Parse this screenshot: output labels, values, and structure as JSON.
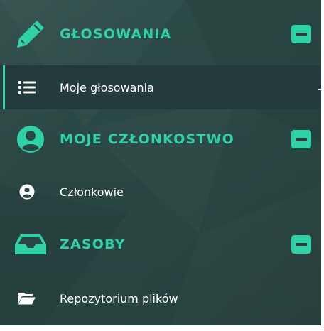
{
  "sections": [
    {
      "title": "GŁOSOWANIA",
      "icon": "pencil-icon",
      "items": [
        {
          "label": "Moje głosowania",
          "icon": "list-icon",
          "active": true
        }
      ]
    },
    {
      "title": "MOJE CZŁONKOSTWO",
      "icon": "user-circle-icon",
      "items": [
        {
          "label": "Członkowie",
          "icon": "user-circle-icon",
          "active": false
        }
      ]
    },
    {
      "title": "ZASOBY",
      "icon": "inbox-tray-icon",
      "items": [
        {
          "label": "Repozytorium plików",
          "icon": "folder-open-icon",
          "active": false
        }
      ]
    }
  ],
  "colors": {
    "accent": "#2fd1a7",
    "background": "#2a4744",
    "active_item_bg": "#243b3e",
    "item_text": "#ffffff"
  }
}
